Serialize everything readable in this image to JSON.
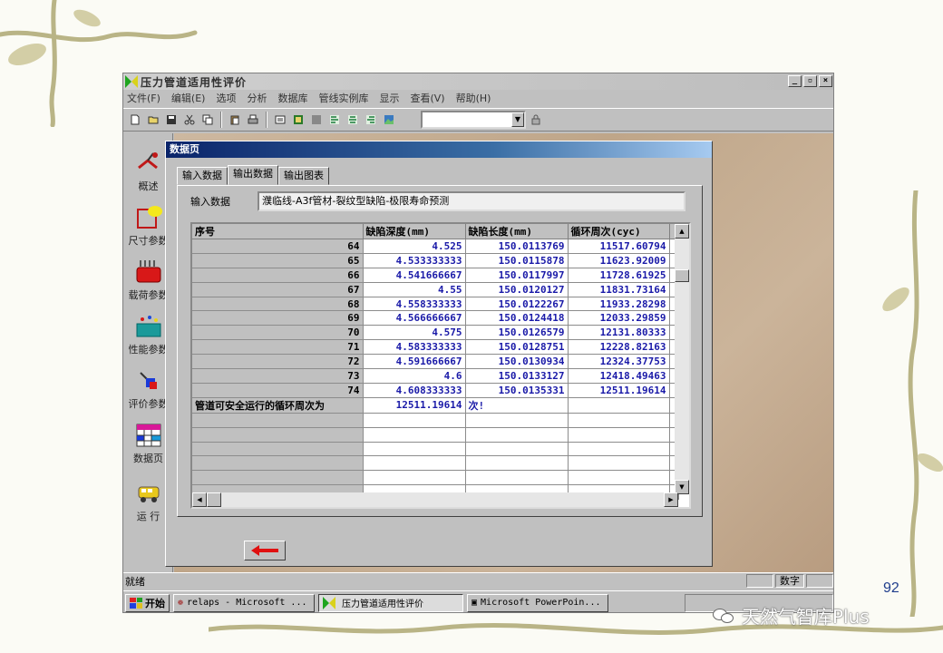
{
  "app": {
    "title": "压力管道适用性评价"
  },
  "window_buttons": {
    "minimize": "_",
    "maximize": "▫",
    "close": "×"
  },
  "menu": [
    {
      "label": "文件(F)"
    },
    {
      "label": "编辑(E)"
    },
    {
      "label": "选项"
    },
    {
      "label": "分析"
    },
    {
      "label": "数据库"
    },
    {
      "label": "管线实例库"
    },
    {
      "label": "显示"
    },
    {
      "label": "查看(V)"
    },
    {
      "label": "帮助(H)"
    }
  ],
  "sidebar": {
    "items": [
      {
        "label": "概述",
        "icon": "overview-icon"
      },
      {
        "label": "尺寸参数",
        "icon": "dimension-icon"
      },
      {
        "label": "载荷参数",
        "icon": "load-icon"
      },
      {
        "label": "性能参数",
        "icon": "performance-icon"
      },
      {
        "label": "评价参数",
        "icon": "evaluation-icon"
      },
      {
        "label": "数据页",
        "icon": "datasheet-icon"
      },
      {
        "label": "运  行",
        "icon": "run-icon"
      }
    ]
  },
  "dialog": {
    "title": "数据页",
    "tabs": [
      {
        "label": "输入数据",
        "active": false
      },
      {
        "label": "输出数据",
        "active": true
      },
      {
        "label": "输出图表",
        "active": false
      }
    ],
    "input_label": "输入数据",
    "input_value": "濮临线-A3f管材-裂纹型缺陷-极限寿命预测",
    "grid": {
      "headers": [
        "序号",
        "缺陷深度(mm)",
        "缺陷长度(mm)",
        "循环周次(cyc)"
      ],
      "rows": [
        {
          "id": "64",
          "depth": "4.525",
          "length": "150.0113769",
          "cycles": "11517.60794"
        },
        {
          "id": "65",
          "depth": "4.533333333",
          "length": "150.0115878",
          "cycles": "11623.92009"
        },
        {
          "id": "66",
          "depth": "4.541666667",
          "length": "150.0117997",
          "cycles": "11728.61925"
        },
        {
          "id": "67",
          "depth": "4.55",
          "length": "150.0120127",
          "cycles": "11831.73164"
        },
        {
          "id": "68",
          "depth": "4.558333333",
          "length": "150.0122267",
          "cycles": "11933.28298"
        },
        {
          "id": "69",
          "depth": "4.566666667",
          "length": "150.0124418",
          "cycles": "12033.29859"
        },
        {
          "id": "70",
          "depth": "4.575",
          "length": "150.0126579",
          "cycles": "12131.80333"
        },
        {
          "id": "71",
          "depth": "4.583333333",
          "length": "150.0128751",
          "cycles": "12228.82163"
        },
        {
          "id": "72",
          "depth": "4.591666667",
          "length": "150.0130934",
          "cycles": "12324.37753"
        },
        {
          "id": "73",
          "depth": "4.6",
          "length": "150.0133127",
          "cycles": "12418.49463"
        },
        {
          "id": "74",
          "depth": "4.608333333",
          "length": "150.0135331",
          "cycles": "12511.19614"
        }
      ],
      "summary": {
        "label": "管道可安全运行的循环周次为",
        "value": "12511.19614",
        "unit": "次!"
      }
    }
  },
  "status": {
    "text": "就绪",
    "num_indicator": "数字"
  },
  "taskbar": {
    "start": "开始",
    "tasks": [
      {
        "label": "relaps - Microsoft ...",
        "active": false
      },
      {
        "label": "压力管道适用性评价",
        "active": true
      },
      {
        "label": "Microsoft PowerPoin...",
        "active": false
      }
    ]
  },
  "slide": {
    "page_number": "92",
    "watermark": "天然气智库Plus"
  },
  "colors": {
    "grid_value": "#1a1aa8",
    "dialog_title": "#0a246a",
    "back_arrow": "#e01010"
  }
}
